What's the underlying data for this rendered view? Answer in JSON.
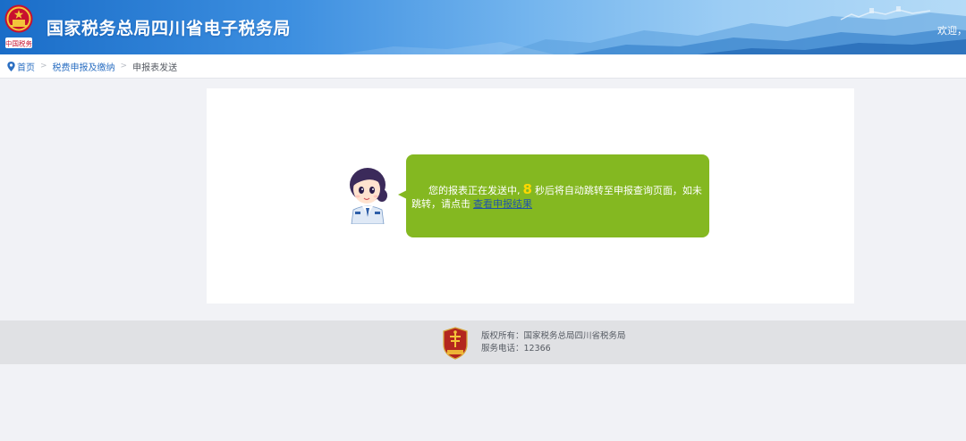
{
  "header": {
    "site_title": "国家税务总局四川省电子税务局",
    "welcome_text": "欢迎，"
  },
  "breadcrumb": {
    "items": [
      {
        "label": "首页"
      },
      {
        "label": "税费申报及缴纳"
      },
      {
        "label": "申报表发送"
      }
    ],
    "separator": ">"
  },
  "message": {
    "text_before": "您的报表正在发送中,",
    "countdown": "8",
    "text_after": "秒后将自动跳转至申报查询页面，如未",
    "text_line2": "跳转，请点击",
    "link_label": "查看申报结果"
  },
  "footer": {
    "copyright": "版权所有：国家税务总局四川省税务局",
    "phone": "服务电话：12366"
  },
  "colors": {
    "bubble": "#84b821",
    "countdown": "#ffd800",
    "link": "#2b6fc2",
    "header_blue": "#1a6dc8"
  },
  "icons": {
    "breadcrumb": "location-pin-icon",
    "header_logo": "national-emblem-icon",
    "footer_logo": "tax-shield-icon"
  }
}
